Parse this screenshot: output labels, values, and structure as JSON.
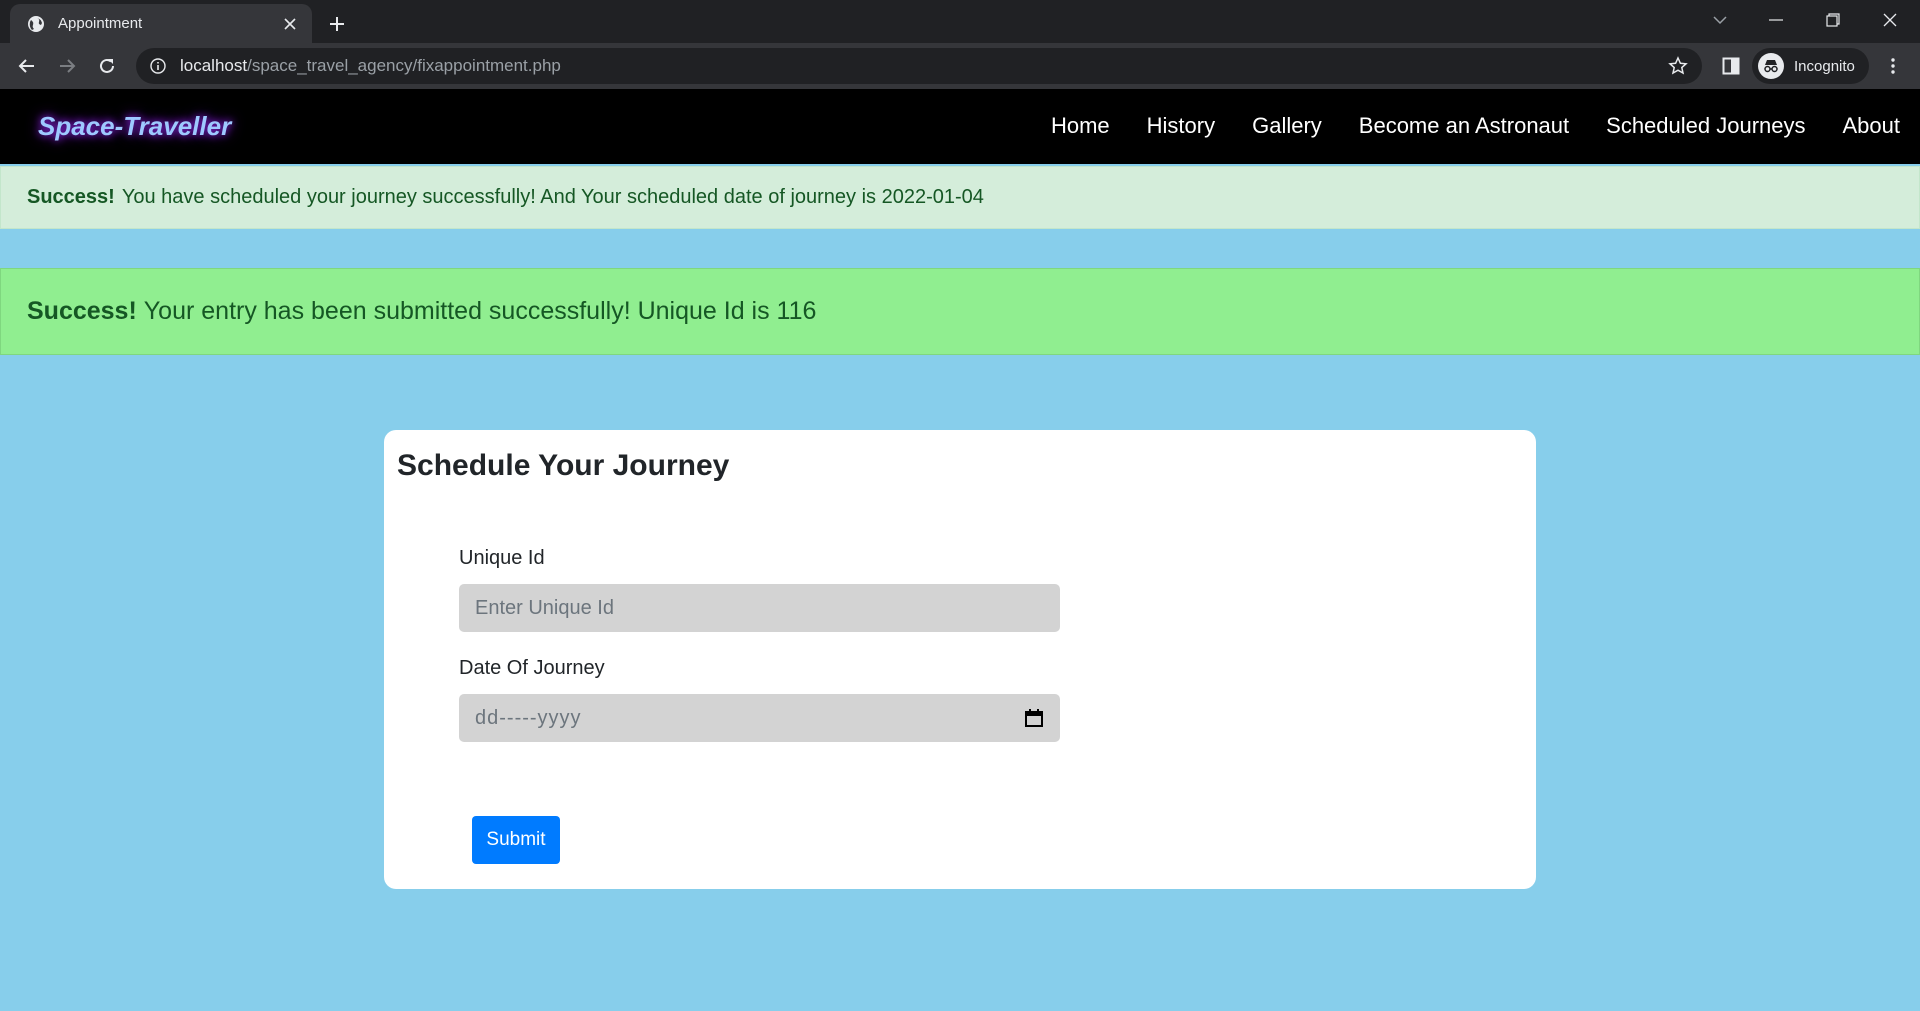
{
  "browser": {
    "tab_title": "Appointment",
    "url_host": "localhost",
    "url_path": "/space_travel_agency/fixappointment.php",
    "profile_label": "Incognito"
  },
  "nav": {
    "brand": "Space-Traveller",
    "links": [
      "Home",
      "History",
      "Gallery",
      "Become an Astronaut",
      "Scheduled Journeys",
      "About"
    ]
  },
  "alerts": [
    {
      "strong": "Success!",
      "message": "You have scheduled your journey successfully! And Your scheduled date of journey is 2022-01-04"
    },
    {
      "strong": "Success!",
      "message": "Your entry has been submitted successfully! Unique Id is 116"
    }
  ],
  "form": {
    "title": "Schedule Your Journey",
    "unique_id_label": "Unique Id",
    "unique_id_placeholder": "Enter Unique Id",
    "date_label": "Date Of Journey",
    "date_placeholder": "dd-----yyyy",
    "submit_label": "Submit"
  },
  "colors": {
    "page_bg": "#87ceeb",
    "navbar_bg": "#000000",
    "alert_success_bg": "#d4edda",
    "alert_entry_bg": "#90ee90",
    "submit_bg": "#007bff"
  }
}
